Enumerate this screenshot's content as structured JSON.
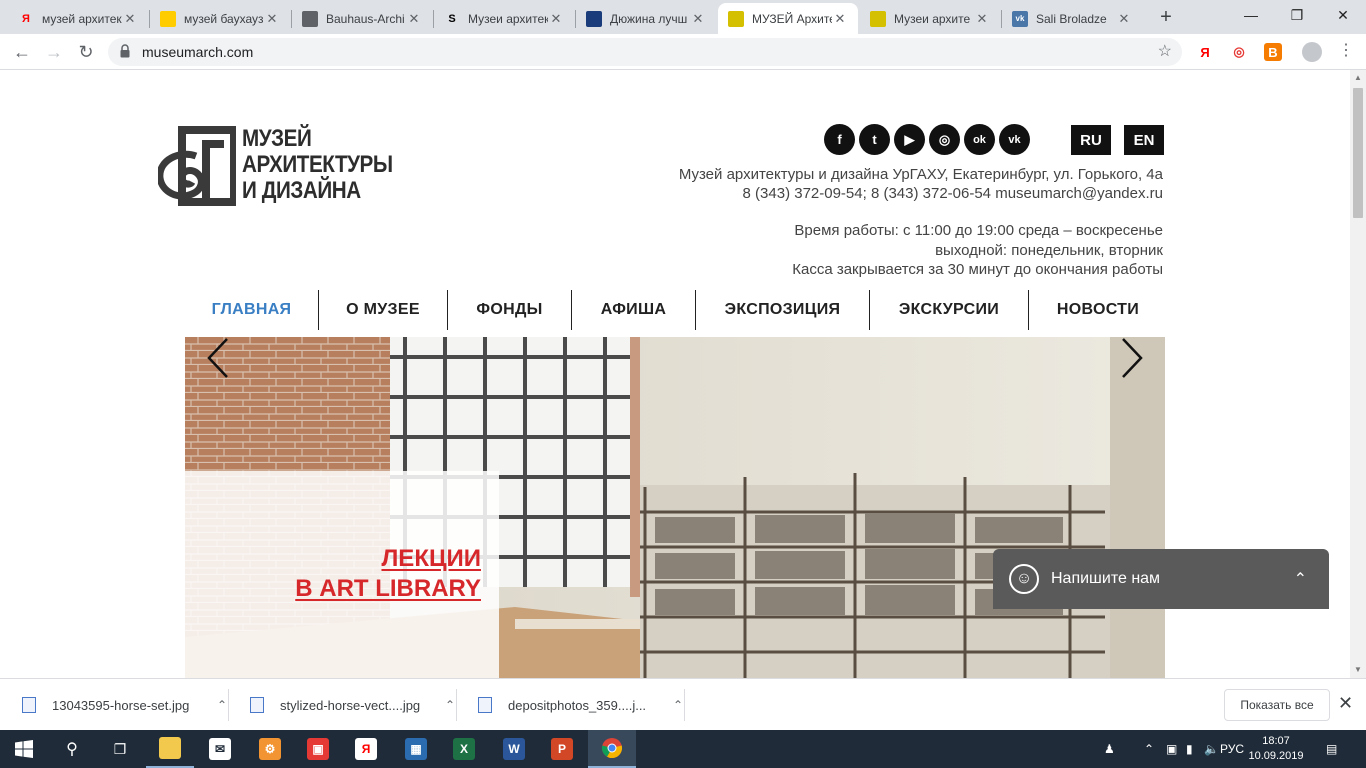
{
  "browser": {
    "tabs": [
      {
        "title": "музей архитек",
        "favicon": "yandex-icon",
        "favicon_text": "Я",
        "color": "#ff0000",
        "active": false
      },
      {
        "title": "музей баухауз",
        "favicon": "yandex-images-icon",
        "favicon_text": "",
        "color": "#ffcc00",
        "active": false
      },
      {
        "title": "Bauhaus-Archi",
        "favicon": "globe-icon",
        "favicon_text": "",
        "color": "#5f6368",
        "active": false
      },
      {
        "title": "Музеи архитек",
        "favicon": "s-icon",
        "favicon_text": "S",
        "color": "#000000",
        "active": false
      },
      {
        "title": "Дюжина лучш",
        "favicon": "grid-icon",
        "favicon_text": "",
        "color": "#1a3c7a",
        "active": false
      },
      {
        "title": "МУЗЕЙ Архите",
        "favicon": "museum-icon",
        "favicon_text": "",
        "color": "#d4c000",
        "active": true
      },
      {
        "title": "Музеи архите",
        "favicon": "museum-icon",
        "favicon_text": "",
        "color": "#d4c000",
        "active": false
      },
      {
        "title": "Sali Broladze",
        "favicon": "vk-icon",
        "favicon_text": "vk",
        "color": "#4a76a8",
        "active": false
      }
    ],
    "url": "museumarch.com",
    "extensions": [
      {
        "name": "yandex-ext-icon",
        "text": "Я",
        "color": "#ff0000"
      },
      {
        "name": "target-ext-icon",
        "text": "◎",
        "color": "#e53935"
      },
      {
        "name": "b-ext-icon",
        "text": "В",
        "color": "#f57c00"
      }
    ]
  },
  "header": {
    "logo_lines": [
      "МУЗЕЙ",
      "АРХИТЕКТУРЫ",
      "И ДИЗАЙНА"
    ],
    "socials": [
      {
        "name": "facebook-icon",
        "glyph": "f"
      },
      {
        "name": "twitter-icon",
        "glyph": "t"
      },
      {
        "name": "youtube-icon",
        "glyph": "▶"
      },
      {
        "name": "instagram-icon",
        "glyph": "◎"
      },
      {
        "name": "odnoklassniki-icon",
        "glyph": "ok"
      },
      {
        "name": "vk-icon",
        "glyph": "vk"
      }
    ],
    "languages": [
      "RU",
      "EN"
    ],
    "address": "Музей архитектуры и дизайна УрГАХУ, Екатеринбург, ул. Горького, 4а",
    "phones": "8 (343) 372-09-54; 8 (343) 372-06-54 museumarch@yandex.ru",
    "hours_1": "Время работы: с 11:00 до 19:00 среда – воскресенье",
    "hours_2": "выходной: понедельник, вторник",
    "hours_3": "Касса закрывается за 30 минут до окончания работы"
  },
  "nav": {
    "items": [
      "ГЛАВНАЯ",
      "О МУЗЕЕ",
      "ФОНДЫ",
      "АФИША",
      "ЭКСПОЗИЦИЯ",
      "ЭКСКУРСИИ",
      "НОВОСТИ"
    ],
    "active_index": 0,
    "active_color": "#3a7fc4"
  },
  "slider": {
    "caption_line1": "ЛЕКЦИИ",
    "caption_line2": "В ART LIBRARY",
    "caption_color": "#d6282b"
  },
  "chat": {
    "label": "Напишите нам"
  },
  "downloads": {
    "items": [
      "13043595-horse-set.jpg",
      "stylized-horse-vect....jpg",
      "depositphotos_359....j..."
    ],
    "show_all": "Показать все"
  },
  "taskbar": {
    "lang": "РУС",
    "time": "18:07",
    "date": "10.09.2019"
  }
}
